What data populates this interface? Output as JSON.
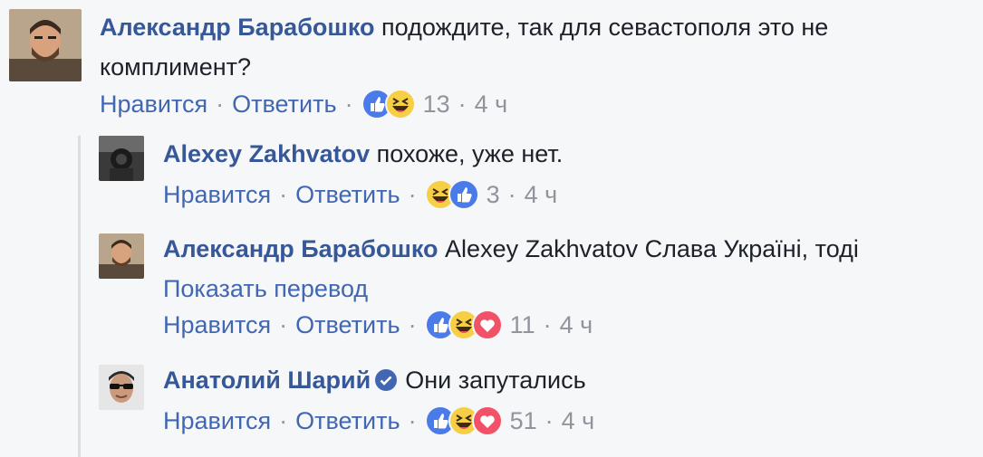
{
  "comments": [
    {
      "author": "Александр Барабошко",
      "text": "подождите, так для севастополя это не комплимент?",
      "like_label": "Нравится",
      "reply_label": "Ответить",
      "reactions": [
        "like-icon",
        "haha-icon"
      ],
      "reaction_count": "13",
      "time": "4 ч"
    },
    {
      "author": "Alexey Zakhvatov",
      "text": "похоже, уже нет.",
      "like_label": "Нравится",
      "reply_label": "Ответить",
      "reactions": [
        "haha-icon",
        "like-icon"
      ],
      "reaction_count": "3",
      "time": "4 ч"
    },
    {
      "author": "Александр Барабошко",
      "text": "Alexey Zakhvatov Слава Україні, тоді",
      "translate_label": "Показать перевод",
      "like_label": "Нравится",
      "reply_label": "Ответить",
      "reactions": [
        "like-icon",
        "haha-icon",
        "love-icon"
      ],
      "reaction_count": "11",
      "time": "4 ч"
    },
    {
      "author": "Анатолий Шарий",
      "verified": true,
      "text": "Они запутались",
      "like_label": "Нравится",
      "reply_label": "Ответить",
      "reactions": [
        "like-icon",
        "haha-icon",
        "love-icon"
      ],
      "reaction_count": "51",
      "time": "4 ч"
    }
  ],
  "separator": "·",
  "colors": {
    "background": "#f6f7f9",
    "author": "#365899",
    "link": "#4267b2",
    "meta": "#90949c",
    "text": "#1d2129"
  }
}
